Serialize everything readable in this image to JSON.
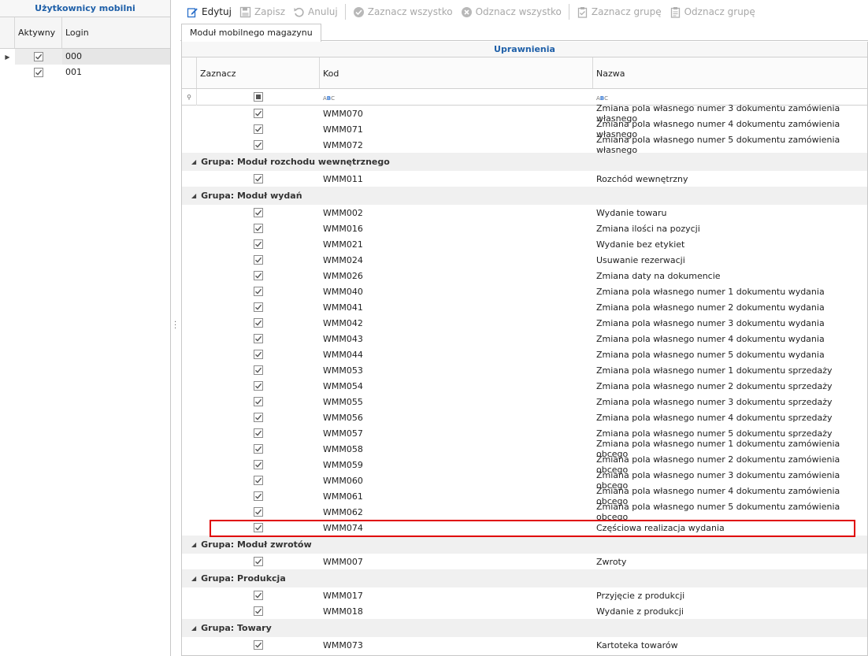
{
  "left_panel": {
    "title": "Użytkownicy mobilni",
    "columns": [
      "Aktywny",
      "Login"
    ],
    "rows": [
      {
        "active": true,
        "login": "000",
        "selected": true
      },
      {
        "active": true,
        "login": "001",
        "selected": false
      }
    ]
  },
  "toolbar": {
    "buttons": [
      {
        "label": "Edytuj",
        "icon": "edit-icon",
        "enabled": true
      },
      {
        "label": "Zapisz",
        "icon": "save-icon",
        "enabled": false
      },
      {
        "label": "Anuluj",
        "icon": "undo-icon",
        "enabled": false
      },
      {
        "label": "Zaznacz wszystko",
        "icon": "check-circle-icon",
        "enabled": false
      },
      {
        "label": "Odznacz wszystko",
        "icon": "x-circle-icon",
        "enabled": false
      },
      {
        "label": "Zaznacz grupę",
        "icon": "clipboard-check-icon",
        "enabled": false
      },
      {
        "label": "Odznacz grupę",
        "icon": "clipboard-icon",
        "enabled": false
      }
    ]
  },
  "tab": {
    "label": "Moduł mobilnego magazynu"
  },
  "grid": {
    "title": "Uprawnienia",
    "columns": {
      "select": "Zaznacz",
      "code": "Kod",
      "name": "Nazwa"
    },
    "filter_icons": {
      "code": "abc-filter-icon",
      "name": "abc-filter-icon"
    },
    "items": [
      {
        "type": "row",
        "code": "WMM070",
        "name": "Zmiana pola własnego numer 3 dokumentu zamówienia własnego"
      },
      {
        "type": "row",
        "code": "WMM071",
        "name": "Zmiana pola własnego numer 4 dokumentu zamówienia własnego"
      },
      {
        "type": "row",
        "code": "WMM072",
        "name": "Zmiana pola własnego numer 5 dokumentu zamówienia własnego"
      },
      {
        "type": "group",
        "label": "Grupa: Moduł rozchodu wewnętrznego"
      },
      {
        "type": "row",
        "code": "WMM011",
        "name": "Rozchód wewnętrzny"
      },
      {
        "type": "group",
        "label": "Grupa: Moduł wydań"
      },
      {
        "type": "row",
        "code": "WMM002",
        "name": "Wydanie towaru"
      },
      {
        "type": "row",
        "code": "WMM016",
        "name": "Zmiana ilości na pozycji"
      },
      {
        "type": "row",
        "code": "WMM021",
        "name": "Wydanie bez etykiet"
      },
      {
        "type": "row",
        "code": "WMM024",
        "name": "Usuwanie rezerwacji"
      },
      {
        "type": "row",
        "code": "WMM026",
        "name": "Zmiana daty na dokumencie"
      },
      {
        "type": "row",
        "code": "WMM040",
        "name": "Zmiana pola własnego numer 1 dokumentu wydania"
      },
      {
        "type": "row",
        "code": "WMM041",
        "name": "Zmiana pola własnego numer 2 dokumentu wydania"
      },
      {
        "type": "row",
        "code": "WMM042",
        "name": "Zmiana pola własnego numer 3 dokumentu wydania"
      },
      {
        "type": "row",
        "code": "WMM043",
        "name": "Zmiana pola własnego numer 4 dokumentu wydania"
      },
      {
        "type": "row",
        "code": "WMM044",
        "name": "Zmiana pola własnego numer 5 dokumentu wydania"
      },
      {
        "type": "row",
        "code": "WMM053",
        "name": "Zmiana pola własnego numer 1 dokumentu sprzedaży"
      },
      {
        "type": "row",
        "code": "WMM054",
        "name": "Zmiana pola własnego numer 2 dokumentu sprzedaży"
      },
      {
        "type": "row",
        "code": "WMM055",
        "name": "Zmiana pola własnego numer 3 dokumentu sprzedaży"
      },
      {
        "type": "row",
        "code": "WMM056",
        "name": "Zmiana pola własnego numer 4 dokumentu sprzedaży"
      },
      {
        "type": "row",
        "code": "WMM057",
        "name": "Zmiana pola własnego numer 5 dokumentu sprzedaży"
      },
      {
        "type": "row",
        "code": "WMM058",
        "name": "Zmiana pola własnego numer 1 dokumentu zamówienia obcego"
      },
      {
        "type": "row",
        "code": "WMM059",
        "name": "Zmiana pola własnego numer 2 dokumentu zamówienia obcego"
      },
      {
        "type": "row",
        "code": "WMM060",
        "name": "Zmiana pola własnego numer 3 dokumentu zamówienia obcego"
      },
      {
        "type": "row",
        "code": "WMM061",
        "name": "Zmiana pola własnego numer 4 dokumentu zamówienia obcego"
      },
      {
        "type": "row",
        "code": "WMM062",
        "name": "Zmiana pola własnego numer 5 dokumentu zamówienia obcego"
      },
      {
        "type": "row",
        "code": "WMM074",
        "name": "Częściowa realizacja wydania",
        "highlighted": true
      },
      {
        "type": "group",
        "label": "Grupa: Moduł zwrotów"
      },
      {
        "type": "row",
        "code": "WMM007",
        "name": "Zwroty"
      },
      {
        "type": "group",
        "label": "Grupa: Produkcja"
      },
      {
        "type": "row",
        "code": "WMM017",
        "name": "Przyjęcie z produkcji"
      },
      {
        "type": "row",
        "code": "WMM018",
        "name": "Wydanie z produkcji"
      },
      {
        "type": "group",
        "label": "Grupa: Towary"
      },
      {
        "type": "row",
        "code": "WMM073",
        "name": "Kartoteka towarów"
      }
    ]
  },
  "colors": {
    "accent": "#1e5fa8",
    "highlight": "#e00000"
  }
}
